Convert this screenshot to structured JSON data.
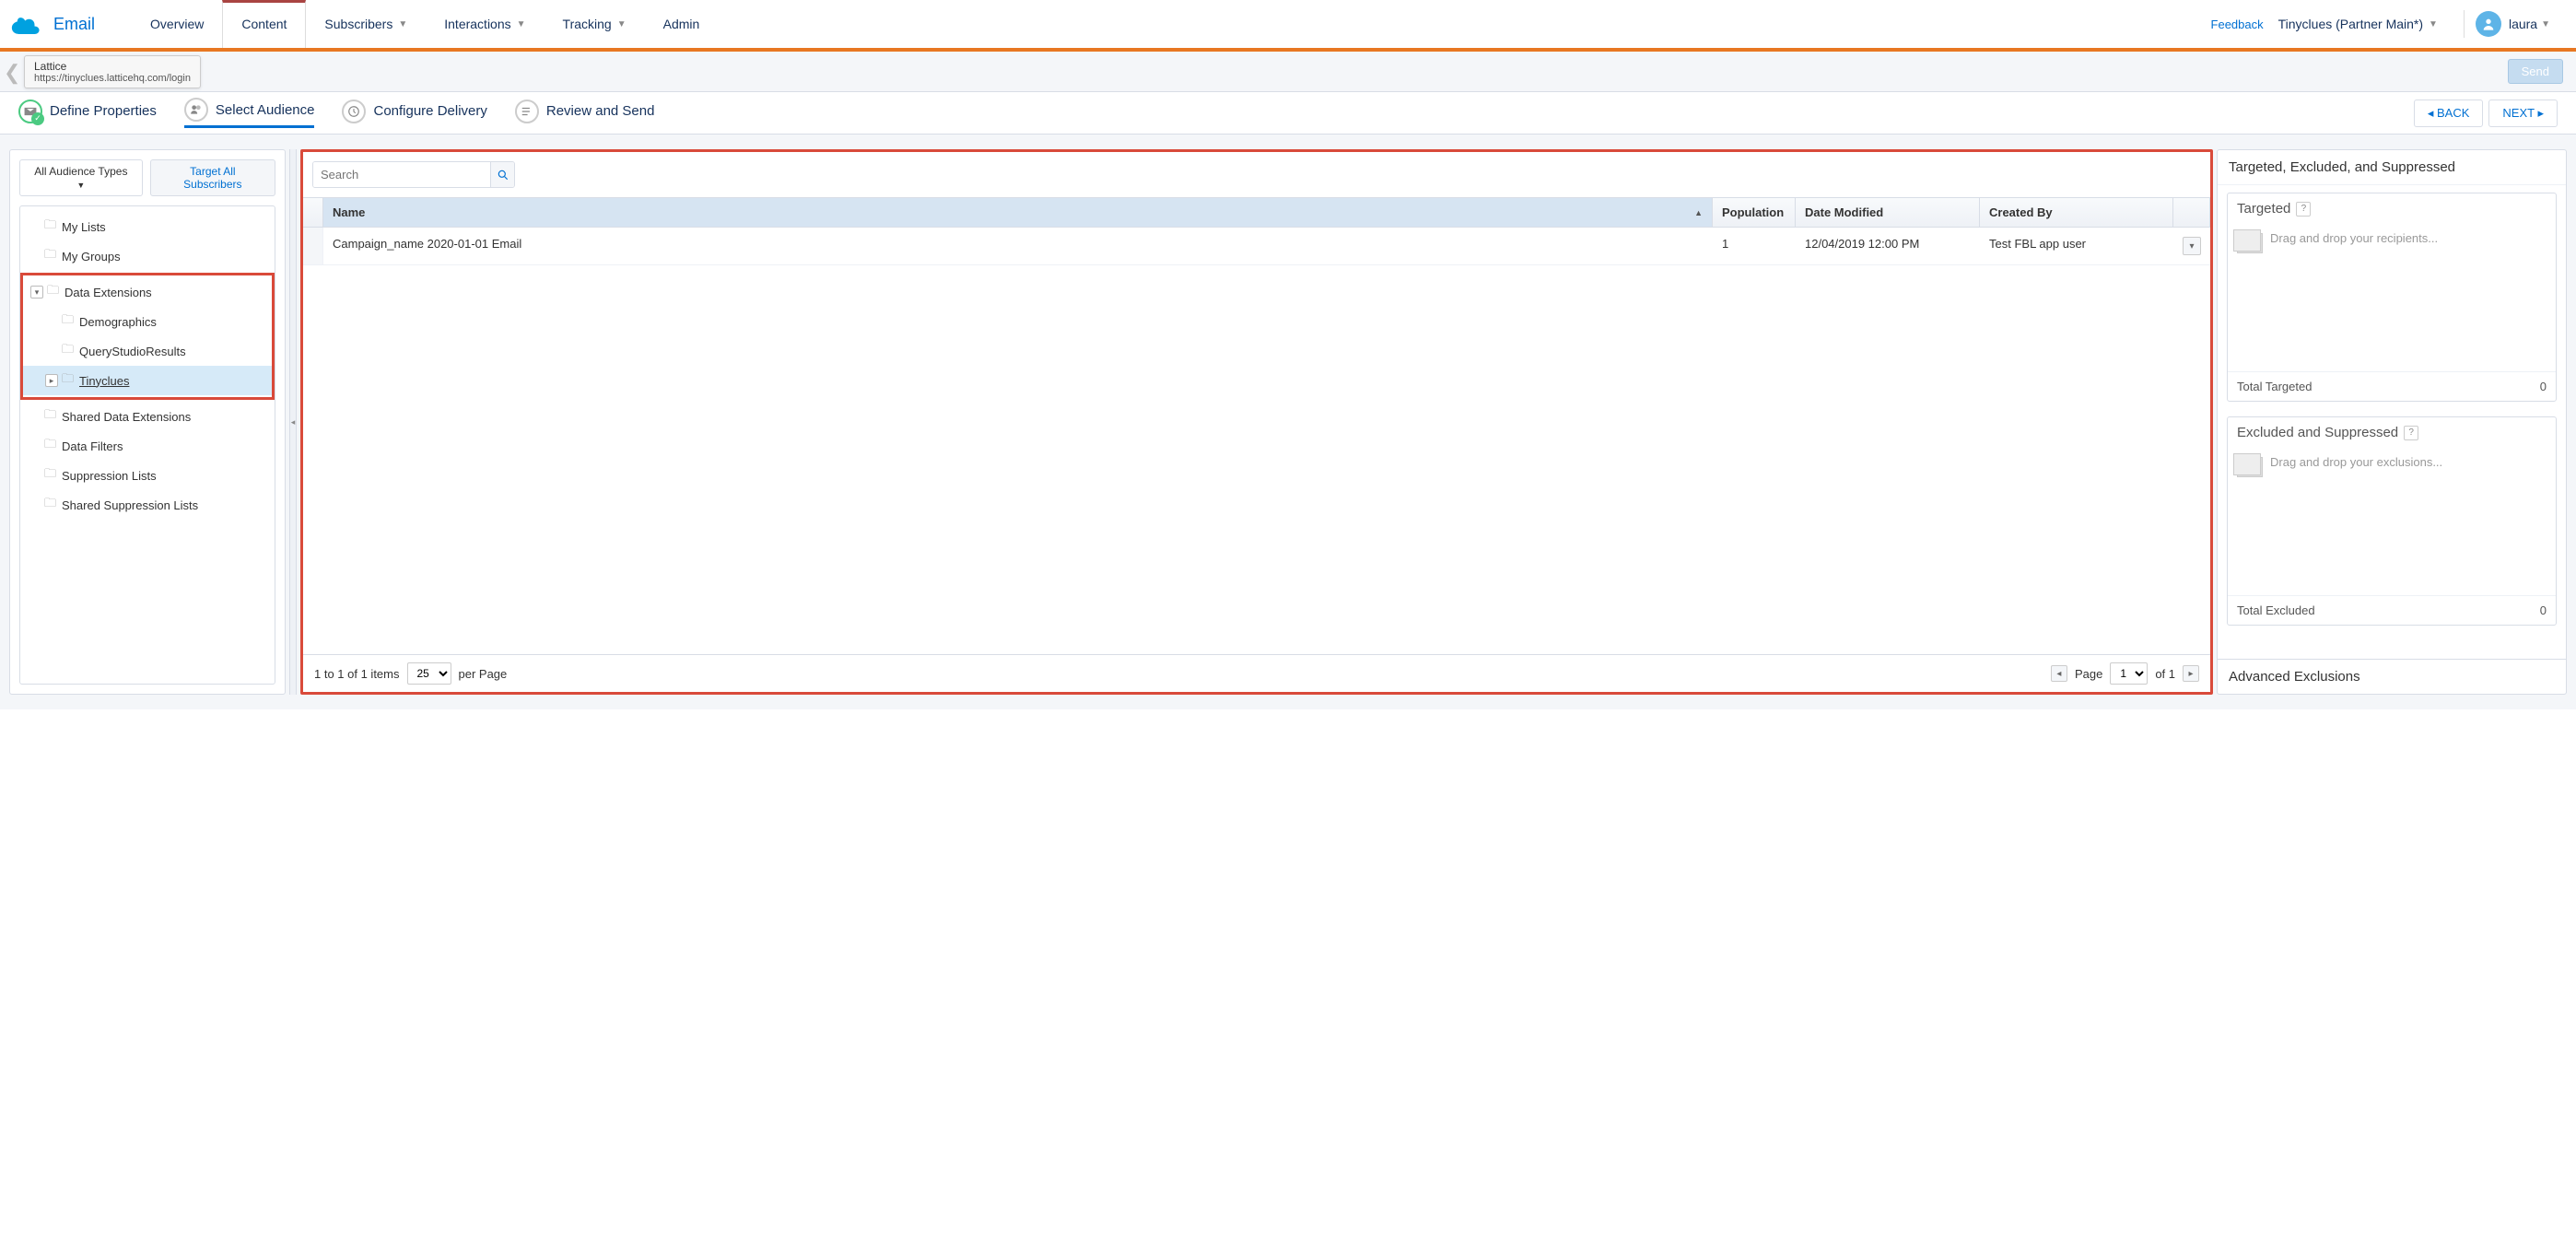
{
  "app": {
    "name": "Email"
  },
  "nav": {
    "tabs": [
      "Overview",
      "Content",
      "Subscribers",
      "Interactions",
      "Tracking",
      "Admin"
    ],
    "active_index": 1,
    "feedback": "Feedback",
    "org": "Tinyclues (Partner Main*)",
    "user": "laura"
  },
  "tooltip": {
    "title": "Lattice",
    "url": "https://tinyclues.latticehq.com/login"
  },
  "send_label": "Send",
  "wizard": {
    "steps": [
      "Define Properties",
      "Select Audience",
      "Configure Delivery",
      "Review and Send"
    ],
    "active_index": 1,
    "back": "BACK",
    "next": "NEXT"
  },
  "left": {
    "filter": "All Audience Types",
    "target_all": "Target All Subscribers",
    "tree": {
      "my_lists": "My Lists",
      "my_groups": "My Groups",
      "data_extensions": "Data Extensions",
      "demographics": "Demographics",
      "query_studio": "QueryStudioResults",
      "tinyclues": "Tinyclues",
      "shared_de": "Shared Data Extensions",
      "data_filters": "Data Filters",
      "suppression": "Suppression Lists",
      "shared_suppression": "Shared Suppression Lists"
    }
  },
  "grid": {
    "search_placeholder": "Search",
    "headers": {
      "name": "Name",
      "population": "Population",
      "date": "Date Modified",
      "by": "Created By"
    },
    "rows": [
      {
        "name": "Campaign_name 2020-01-01 Email",
        "population": "1",
        "date": "12/04/2019 12:00 PM",
        "by": "Test FBL app user"
      }
    ],
    "pager": {
      "summary": "1 to 1 of 1 items",
      "page_size": "25",
      "per_page": "per Page",
      "page_label": "Page",
      "page": "1",
      "of": "of 1"
    }
  },
  "right": {
    "header": "Targeted, Excluded, and Suppressed",
    "targeted": {
      "title": "Targeted",
      "hint": "Drag and drop your recipients...",
      "total_label": "Total Targeted",
      "total": "0"
    },
    "excluded": {
      "title": "Excluded and Suppressed",
      "hint": "Drag and drop your exclusions...",
      "total_label": "Total Excluded",
      "total": "0"
    },
    "advanced": "Advanced Exclusions"
  }
}
